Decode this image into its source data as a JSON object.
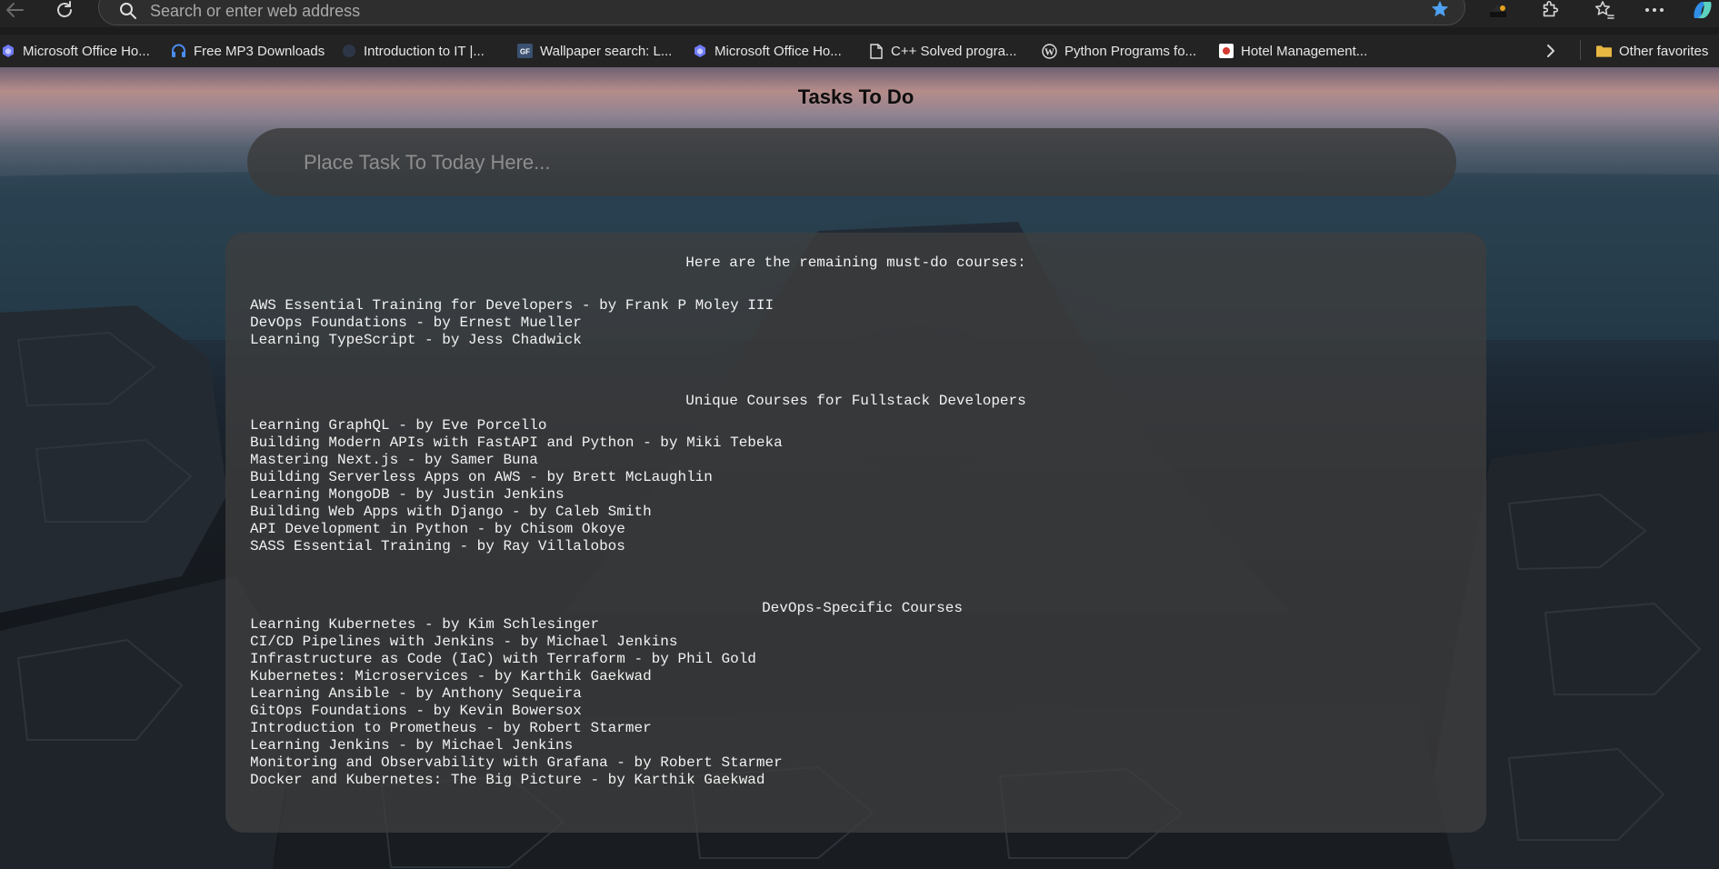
{
  "browser": {
    "address_placeholder": "Search or enter web address",
    "bookmarks": [
      {
        "label": "Microsoft Office Ho...",
        "icon": "office-icon"
      },
      {
        "label": "Free MP3 Downloads",
        "icon": "headphones-icon"
      },
      {
        "label": "Introduction to IT |...",
        "icon": "site-icon"
      },
      {
        "label": "Wallpaper search: L...",
        "icon": "gf-icon"
      },
      {
        "label": "Microsoft Office Ho...",
        "icon": "office-icon"
      },
      {
        "label": "C++ Solved progra...",
        "icon": "document-icon"
      },
      {
        "label": "Python Programs fo...",
        "icon": "wordpress-icon"
      },
      {
        "label": "Hotel Management...",
        "icon": "site-icon"
      }
    ],
    "other_favorites": "Other favorites",
    "colors": {
      "chrome": "#232323",
      "favorite_star": "#4ea1f3"
    }
  },
  "page": {
    "title": "Tasks To Do",
    "task_input_placeholder": "Place Task To Today Here...",
    "sections": [
      {
        "heading": "Here are the remaining must-do courses:",
        "courses": [
          "AWS Essential Training for Developers - by Frank P Moley III",
          "DevOps Foundations - by Ernest Mueller",
          "Learning TypeScript - by Jess Chadwick"
        ]
      },
      {
        "heading": "Unique Courses for Fullstack Developers",
        "courses": [
          "Learning GraphQL - by Eve Porcello",
          "Building Modern APIs with FastAPI and Python - by Miki Tebeka",
          "Mastering Next.js - by Samer Buna",
          "Building Serverless Apps on AWS - by Brett McLaughlin",
          "Learning MongoDB - by Justin Jenkins",
          "Building Web Apps with Django - by Caleb Smith",
          "API Development in Python - by Chisom Okoye",
          "SASS Essential Training - by Ray Villalobos"
        ]
      },
      {
        "heading": "DevOps-Specific Courses",
        "courses": [
          "Learning Kubernetes - by Kim Schlesinger",
          "CI/CD Pipelines with Jenkins - by Michael Jenkins",
          "Infrastructure as Code (IaC) with Terraform - by Phil Gold",
          "Kubernetes: Microservices - by Karthik Gaekwad",
          "Learning Ansible - by Anthony Sequeira",
          "GitOps Foundations - by Kevin Bowersox",
          "Introduction to Prometheus - by Robert Starmer",
          "Learning Jenkins - by Michael Jenkins",
          "Monitoring and Observability with Grafana - by Robert Starmer",
          "Docker and Kubernetes: The Big Picture - by Karthik Gaekwad"
        ]
      }
    ]
  }
}
